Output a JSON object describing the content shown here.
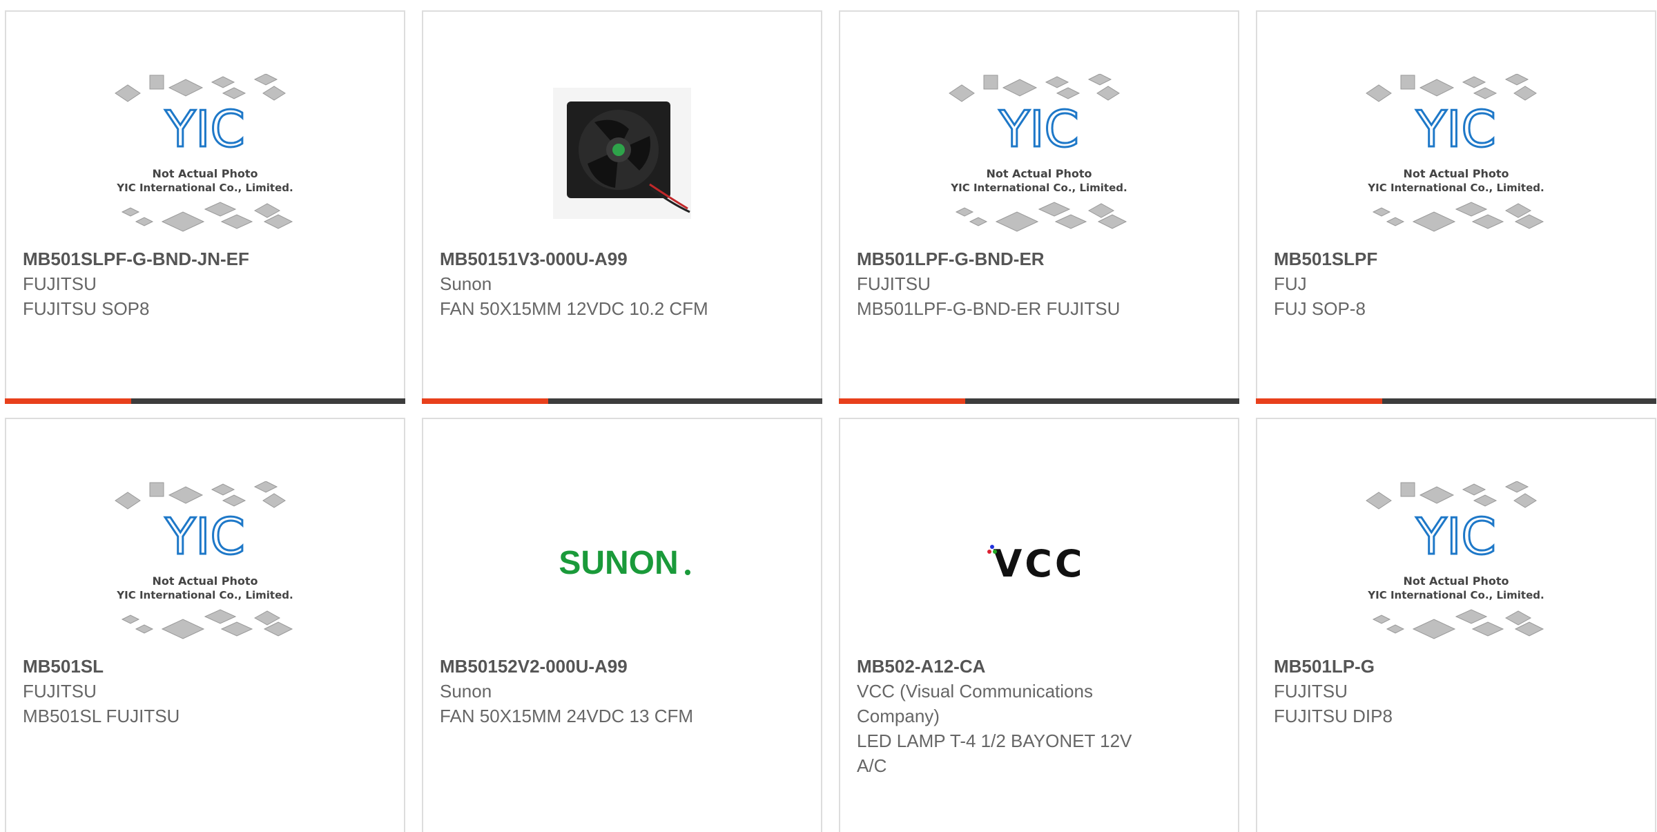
{
  "colors": {
    "accent": "#e8401c",
    "bar": "#3d3d3d",
    "yic_blue": "#1e78c8",
    "sunon_green": "#1a9a3a"
  },
  "placeholder": {
    "line1": "Not Actual Photo",
    "line2": "YIC International Co., Limited.",
    "logo": "YIC"
  },
  "products": [
    {
      "part": "MB501SLPF-G-BND-JN-EF",
      "mfr": "FUJITSU",
      "desc": "FUJITSU SOP8",
      "image": "placeholder"
    },
    {
      "part": "MB50151V3-000U-A99",
      "mfr": "Sunon",
      "desc": "FAN 50X15MM 12VDC 10.2 CFM",
      "image": "fan-photo"
    },
    {
      "part": "MB501LPF-G-BND-ER",
      "mfr": "FUJITSU",
      "desc": "MB501LPF-G-BND-ER FUJITSU",
      "image": "placeholder"
    },
    {
      "part": "MB501SLPF",
      "mfr": "FUJ",
      "desc": "FUJ SOP-8",
      "image": "placeholder"
    },
    {
      "part": "MB501SL",
      "mfr": "FUJITSU",
      "desc": "MB501SL FUJITSU",
      "image": "placeholder"
    },
    {
      "part": "MB50152V2-000U-A99",
      "mfr": "Sunon",
      "desc": "FAN 50X15MM 24VDC 13 CFM",
      "image": "sunon-logo",
      "logo_text": "SUNON"
    },
    {
      "part": "MB502-A12-CA",
      "mfr": "VCC (Visual Communications Company)",
      "desc": "LED LAMP T-4 1/2 BAYONET 12V A/C",
      "image": "vcc-logo",
      "logo_text": "VCC"
    },
    {
      "part": "MB501LP-G",
      "mfr": "FUJITSU",
      "desc": "FUJITSU DIP8",
      "image": "placeholder"
    }
  ]
}
